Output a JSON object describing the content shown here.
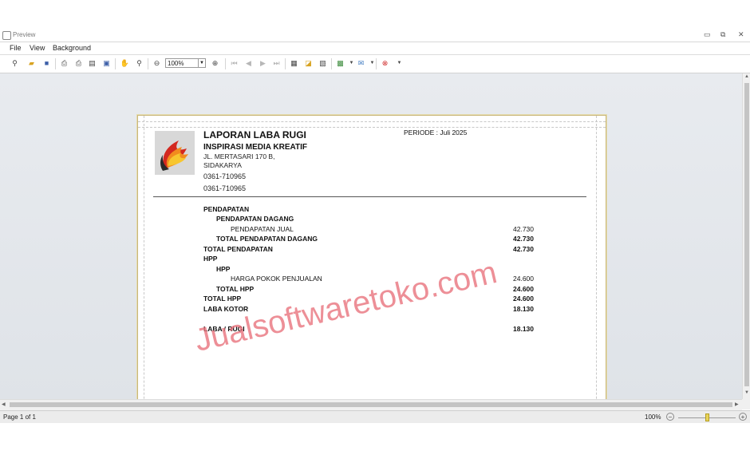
{
  "window": {
    "title": "Preview",
    "controls": {
      "minimize": "▭",
      "restore": "⧉",
      "close": "✕"
    }
  },
  "menu": {
    "items": [
      "File",
      "View",
      "Background"
    ]
  },
  "toolbar": {
    "zoom_value": "100%"
  },
  "report": {
    "title": "LAPORAN LABA RUGI",
    "periode": "PERIODE : Juli 2025",
    "company": "INSPIRASI MEDIA KREATIF",
    "address_line1": "JL. MERTASARI 170 B,",
    "address_line2": "SIDAKARYA",
    "phone1": "0361-710965",
    "phone2": "0361-710965",
    "rows": [
      {
        "label": "PENDAPATAN",
        "value": "",
        "indent": 0,
        "bold": true
      },
      {
        "label": "PENDAPATAN DAGANG",
        "value": "",
        "indent": 1,
        "bold": true
      },
      {
        "label": "PENDAPATAN JUAL",
        "value": "42.730",
        "indent": 2,
        "bold": false
      },
      {
        "label": "TOTAL PENDAPATAN DAGANG",
        "value": "42.730",
        "indent": 1,
        "bold": true
      },
      {
        "label": "TOTAL PENDAPATAN",
        "value": "42.730",
        "indent": 0,
        "bold": true
      },
      {
        "label": "HPP",
        "value": "",
        "indent": 0,
        "bold": true
      },
      {
        "label": "HPP",
        "value": "",
        "indent": 1,
        "bold": true
      },
      {
        "label": "HARGA POKOK PENJUALAN",
        "value": "24.600",
        "indent": 2,
        "bold": false
      },
      {
        "label": "TOTAL HPP",
        "value": "24.600",
        "indent": 1,
        "bold": true
      },
      {
        "label": "TOTAL HPP",
        "value": "24.600",
        "indent": 0,
        "bold": true
      },
      {
        "label": "LABA KOTOR",
        "value": "18.130",
        "indent": 0,
        "bold": true
      },
      {
        "label": "LABA / RUGI",
        "value": "18.130",
        "indent": 0,
        "bold": true
      }
    ]
  },
  "watermark": "Jualsoftwaretoko.com",
  "status": {
    "page": "Page 1 of 1",
    "zoom": "100%",
    "zoom_level_percent": 50
  }
}
